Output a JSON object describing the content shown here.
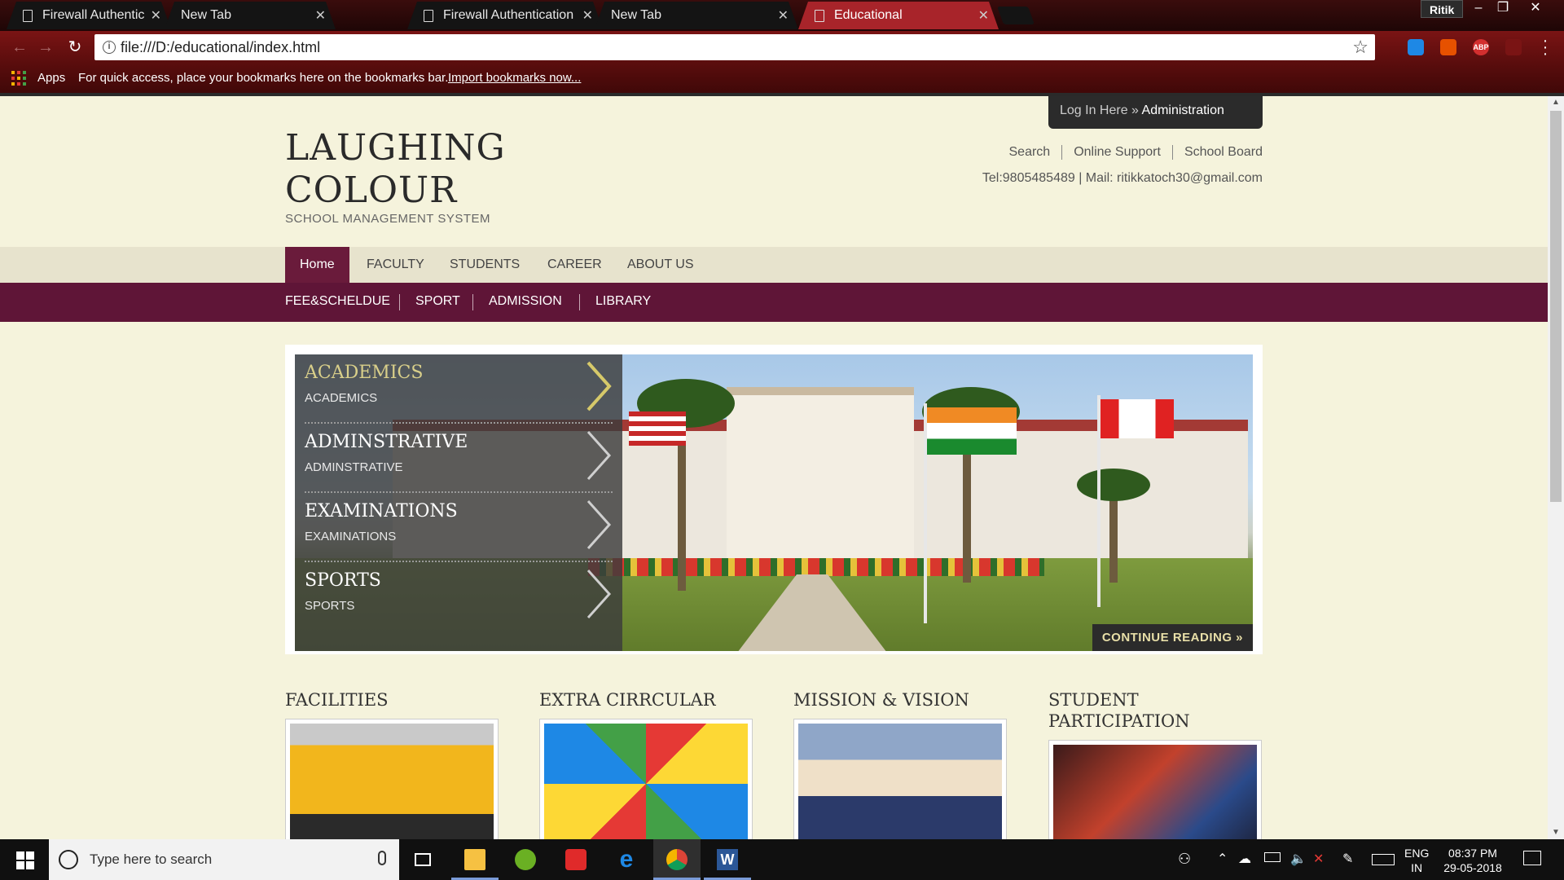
{
  "browser": {
    "tabs": [
      {
        "title": "Firewall Authentication K",
        "active": false
      },
      {
        "title": "New Tab",
        "active": false
      },
      {
        "title": "Firewall Authentication K",
        "active": false
      },
      {
        "title": "New Tab",
        "active": false
      },
      {
        "title": "Educational",
        "active": true
      }
    ],
    "profile": "Ritik",
    "url": "file:///D:/educational/index.html",
    "bookmarks": {
      "apps_label": "Apps",
      "message": "For quick access, place your bookmarks here on the bookmarks bar.",
      "import_link": "Import bookmarks now..."
    },
    "extensions": [
      {
        "name": "extension-icon-1",
        "color": "#1e88e5",
        "text": ""
      },
      {
        "name": "extension-icon-2",
        "color": "#e65100",
        "text": ""
      },
      {
        "name": "adblock-plus-icon",
        "color": "#d32f2f",
        "text": "ABP"
      },
      {
        "name": "extension-icon-4",
        "color": "#7a1414",
        "text": ""
      }
    ]
  },
  "site": {
    "login": {
      "prefix": "Log In Here »",
      "admin": "Administration"
    },
    "logo": {
      "line1": "LAUGHING",
      "line2": "COLOUR",
      "subtitle": "SCHOOL MANAGEMENT SYSTEM"
    },
    "top_links": [
      "Search",
      "Online Support",
      "School Board"
    ],
    "contact": "Tel:9805485489 | Mail: ritikkatoch30@gmail.com",
    "main_nav": [
      "Home",
      "FACULTY",
      "STUDENTS",
      "CAREER",
      "ABOUT US"
    ],
    "sub_nav": [
      "FEE&SCHELDUE",
      "SPORT",
      "ADMISSION",
      "LIBRARY"
    ],
    "slider": {
      "items": [
        {
          "title": "ACADEMICS",
          "subtitle": "ACADEMICS"
        },
        {
          "title": "ADMINSTRATIVE",
          "subtitle": "ADMINSTRATIVE"
        },
        {
          "title": "EXAMINATIONS",
          "subtitle": "EXAMINATIONS"
        },
        {
          "title": "SPORTS",
          "subtitle": "SPORTS"
        }
      ],
      "continue_label": "CONTINUE READING »"
    },
    "features": [
      {
        "title": "FACILITIES"
      },
      {
        "title": "EXTRA CIRRCULAR"
      },
      {
        "title": "MISSION & VISION"
      },
      {
        "title": "STUDENT PARTICIPATION"
      }
    ],
    "colors": {
      "primary": "#5f1537",
      "active_nav": "#6a1b3b",
      "background": "#f5f3dc"
    }
  },
  "taskbar": {
    "search_placeholder": "Type here to search",
    "lang": "ENG",
    "region": "IN",
    "time": "08:37 PM",
    "date": "29-05-2018"
  }
}
